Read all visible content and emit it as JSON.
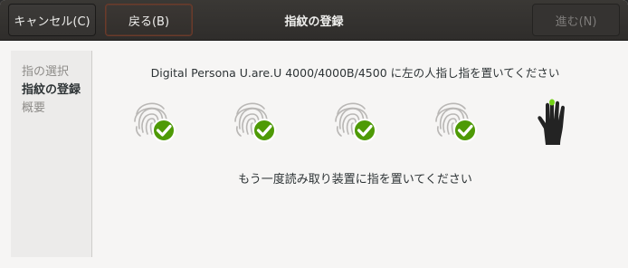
{
  "header": {
    "cancel_label": "キャンセル(C)",
    "back_label": "戻る(B)",
    "title": "指紋の登録",
    "next_label": "進む(N)"
  },
  "sidebar": {
    "items": [
      {
        "label": "指の選択"
      },
      {
        "label": "指紋の登録"
      },
      {
        "label": "概要"
      }
    ]
  },
  "main": {
    "instruction": "Digital Persona U.are.U 4000/4000B/4500 に左の人指し指を置いてください",
    "status": "もう一度読み取り装置に指を置いてください",
    "scans": [
      {
        "state": "success",
        "icon": "fingerprint-check-icon"
      },
      {
        "state": "success",
        "icon": "fingerprint-check-icon"
      },
      {
        "state": "success",
        "icon": "fingerprint-check-icon"
      },
      {
        "state": "success",
        "icon": "fingerprint-check-icon"
      }
    ],
    "hand_icon": "left-hand-index-icon"
  },
  "colors": {
    "headerbar": "#2f2d2b",
    "check_green": "#4e9a06",
    "accent_orange": "#e95420",
    "hand_highlight": "#73d216"
  }
}
